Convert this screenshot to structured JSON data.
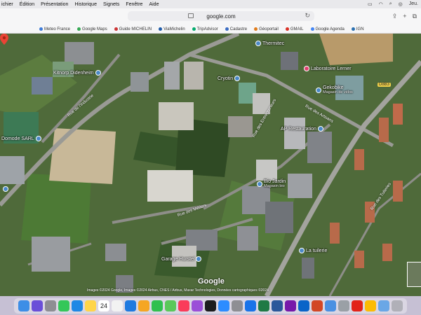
{
  "menubar": {
    "items": [
      "ichier",
      "Édition",
      "Présentation",
      "Historique",
      "Signets",
      "Fenêtre",
      "Aide"
    ],
    "clock": "Jeu."
  },
  "toolbar": {
    "url": "google.com"
  },
  "bookmarks": [
    {
      "label": "Meteo France",
      "color": "#3c7ad9"
    },
    {
      "label": "Google Maps",
      "color": "#34a853"
    },
    {
      "label": "Guide MICHELIN",
      "color": "#c33"
    },
    {
      "label": "ViaMichelin",
      "color": "#1e5aa8"
    },
    {
      "label": "TripAdvisor",
      "color": "#00aa6c"
    },
    {
      "label": "Cadastre",
      "color": "#3a6bc2"
    },
    {
      "label": "Géoportail",
      "color": "#e07b1a"
    },
    {
      "label": "GMAIL",
      "color": "#d93025"
    },
    {
      "label": "Google Agenda",
      "color": "#4285f4"
    },
    {
      "label": "IGN",
      "color": "#2a6fb0"
    }
  ],
  "map": {
    "pois": [
      {
        "name": "Thermitec",
        "sub": ""
      },
      {
        "name": "Laboratoire Lerner",
        "sub": ""
      },
      {
        "name": "Gekobike",
        "sub": "Magasin de vélos"
      },
      {
        "name": "Cryotin",
        "sub": ""
      },
      {
        "name": "Kitnorp Didenheim",
        "sub": ""
      },
      {
        "name": "Domode SARL",
        "sub": ""
      },
      {
        "name": "AP Restauration",
        "sub": ""
      },
      {
        "name": "Bio Jardin",
        "sub": "Magasin bio"
      },
      {
        "name": "Garage Hurstel",
        "sub": ""
      },
      {
        "name": "La tuilerie",
        "sub": ""
      }
    ],
    "streets": [
      "Rue de l'Industrie",
      "Rue des Artisans",
      "Rue des Entrepreneurs",
      "Rue des Métiers",
      "Rue des Tuileries"
    ],
    "road_badge": "D8B3",
    "google_label": "Google",
    "attribution": "Images ©2024 Google, Images ©2024 Airbus, CNES / Airbus, Maxar Technologies, Données cartographiques ©2024"
  },
  "dock": {
    "date_day": "24",
    "apps": [
      {
        "name": "finder",
        "color": "#3d8ee6"
      },
      {
        "name": "siri",
        "color": "#6a4fd8"
      },
      {
        "name": "launchpad",
        "color": "#8e8e93"
      },
      {
        "name": "messages",
        "color": "#34c759"
      },
      {
        "name": "mail",
        "color": "#1e88e5"
      },
      {
        "name": "notes",
        "color": "#ffd54a"
      },
      {
        "name": "calendar",
        "color": "#ffffff"
      },
      {
        "name": "reminders",
        "color": "#f2f2f2"
      },
      {
        "name": "safari",
        "color": "#1f7ae0"
      },
      {
        "name": "photos",
        "color": "#f5a623"
      },
      {
        "name": "facetime",
        "color": "#30c04f"
      },
      {
        "name": "maps",
        "color": "#5ac85a"
      },
      {
        "name": "music",
        "color": "#fa3c5a"
      },
      {
        "name": "podcasts",
        "color": "#9b4fd8"
      },
      {
        "name": "tv",
        "color": "#1c1c1e"
      },
      {
        "name": "appstore",
        "color": "#2d8cff"
      },
      {
        "name": "settings",
        "color": "#8e8e93"
      },
      {
        "name": "onedrive",
        "color": "#1a73e8"
      },
      {
        "name": "excel",
        "color": "#1f7a45"
      },
      {
        "name": "word",
        "color": "#2b579a"
      },
      {
        "name": "onenote",
        "color": "#7719aa"
      },
      {
        "name": "outlook",
        "color": "#0a64c8"
      },
      {
        "name": "powerpoint",
        "color": "#d24726"
      },
      {
        "name": "finder2",
        "color": "#4a90e2"
      },
      {
        "name": "preview",
        "color": "#9aa0a6"
      },
      {
        "name": "acrobat",
        "color": "#e2231a"
      },
      {
        "name": "chrome",
        "color": "#fbbc05"
      },
      {
        "name": "folder",
        "color": "#6aa7e6"
      },
      {
        "name": "trash",
        "color": "#b0b0b8"
      }
    ]
  }
}
